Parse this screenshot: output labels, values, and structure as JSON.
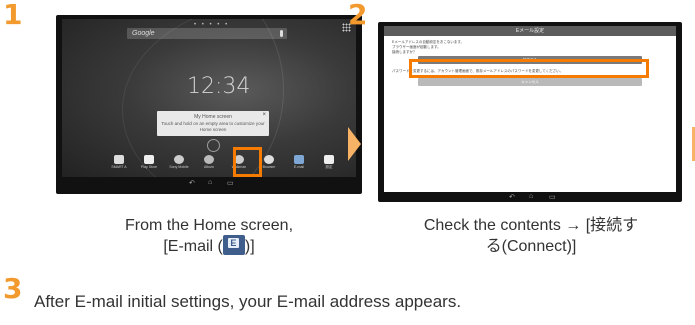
{
  "steps": {
    "step1": {
      "number": "1",
      "caption_line1": "From the Home screen,",
      "caption_line2_pre": "[E-mail (",
      "caption_line2_post": ")]",
      "tablet": {
        "search_label": "Google",
        "clock": "12:34",
        "tip_title": "My Home screen",
        "tip_body": "Touch and hold on an empty area to customize your Home screen",
        "dock_items": [
          {
            "label": "SMART A",
            "icon": "apps-icon",
            "color": "#dddddd"
          },
          {
            "label": "Play Store",
            "icon": "play-store-icon",
            "color": "#eeeeee"
          },
          {
            "label": "Sony Mobile",
            "icon": "sony-icon",
            "color": "#cccccc"
          },
          {
            "label": "Album",
            "icon": "album-icon",
            "color": "#bbbbbb"
          },
          {
            "label": "Walkman",
            "icon": "walkman-icon",
            "color": "#cccccc"
          },
          {
            "label": "Browser",
            "icon": "browser-icon",
            "color": "#dddddd"
          },
          {
            "label": "E-mail",
            "icon": "email-icon",
            "color": "#7fa7d6"
          },
          {
            "label": "設定",
            "icon": "settings-icon",
            "color": "#eeeeee"
          }
        ]
      }
    },
    "step2": {
      "number": "2",
      "caption_line1": "Check the contents → [接続す",
      "caption_line2": "る(Connect)]",
      "tablet": {
        "title": "Eメール設定",
        "text_lines": [
          "Eメールアドレスの自動設定をおこないます。",
          "ブラウザー画面が起動します。",
          "接続しますか？"
        ],
        "button1": "接続する",
        "note": "パスワードを変更するには、アカウント管理画面で、既存メールアドレスのパスワードを変更してください。",
        "button2": "キャンセル"
      }
    },
    "step3": {
      "number": "3",
      "caption": "After E-mail initial settings, your E-mail address appears."
    }
  },
  "icons": {
    "arrow": "chevron-right-icon",
    "email_inline": "email-icon"
  },
  "colors": {
    "accent": "#f57c00",
    "step_number": "#f39a2e",
    "arrow": "#f7b265"
  }
}
